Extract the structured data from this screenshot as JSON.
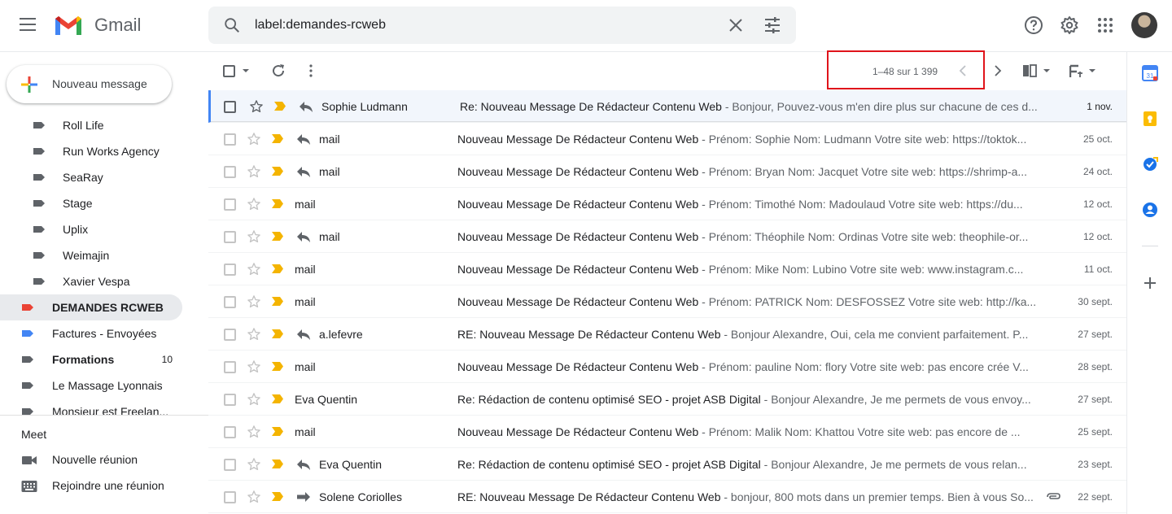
{
  "header": {
    "app_name": "Gmail",
    "search_query": "label:demandes-rcweb"
  },
  "sidebar": {
    "compose_label": "Nouveau message",
    "items": [
      {
        "label": "Roll Life",
        "color": "#5f6368"
      },
      {
        "label": "Run Works Agency",
        "color": "#5f6368"
      },
      {
        "label": "SeaRay",
        "color": "#5f6368"
      },
      {
        "label": "Stage",
        "color": "#5f6368"
      },
      {
        "label": "Uplix",
        "color": "#5f6368"
      },
      {
        "label": "Weimajin",
        "color": "#5f6368"
      },
      {
        "label": "Xavier Vespa",
        "color": "#5f6368"
      },
      {
        "label": "DEMANDES RCWEB",
        "color": "#ea4335",
        "active": true
      },
      {
        "label": "Factures - Envoyées",
        "color": "#4285f4"
      },
      {
        "label": "Formations",
        "color": "#5f6368",
        "count": "10",
        "bold": true
      },
      {
        "label": "Le Massage Lyonnais",
        "color": "#5f6368"
      },
      {
        "label": "Monsieur est Freelan...",
        "color": "#5f6368"
      }
    ],
    "meet": {
      "title": "Meet",
      "new_meeting": "Nouvelle réunion",
      "join_meeting": "Rejoindre une réunion"
    }
  },
  "toolbar": {
    "pagination": "1–48 sur 1 399"
  },
  "emails": [
    {
      "sender": "Sophie Ludmann",
      "reply": true,
      "subject": "Re: Nouveau Message De Rédacteur Contenu Web",
      "snippet": " - Bonjour, Pouvez-vous m'en dire plus sur chacune de ces d...",
      "date": "1 nov."
    },
    {
      "sender": "mail",
      "reply": true,
      "subject": "Nouveau Message De Rédacteur Contenu Web",
      "snippet": " - Prénom: Sophie Nom: Ludmann Votre site web: https://toktok...",
      "date": "25 oct."
    },
    {
      "sender": "mail",
      "reply": true,
      "subject": "Nouveau Message De Rédacteur Contenu Web",
      "snippet": " - Prénom: Bryan Nom: Jacquet Votre site web: https://shrimp-a...",
      "date": "24 oct."
    },
    {
      "sender": "mail",
      "reply": false,
      "subject": "Nouveau Message De Rédacteur Contenu Web",
      "snippet": " - Prénom: Timothé Nom: Madoulaud Votre site web: https://du...",
      "date": "12 oct."
    },
    {
      "sender": "mail",
      "reply": true,
      "subject": "Nouveau Message De Rédacteur Contenu Web",
      "snippet": " - Prénom: Théophile Nom: Ordinas Votre site web: theophile-or...",
      "date": "12 oct."
    },
    {
      "sender": "mail",
      "reply": false,
      "subject": "Nouveau Message De Rédacteur Contenu Web",
      "snippet": " - Prénom: Mike Nom: Lubino Votre site web: www.instagram.c...",
      "date": "11 oct."
    },
    {
      "sender": "mail",
      "reply": false,
      "subject": "Nouveau Message De Rédacteur Contenu Web",
      "snippet": " - Prénom: PATRICK Nom: DESFOSSEZ Votre site web: http://ka...",
      "date": "30 sept."
    },
    {
      "sender": "a.lefevre",
      "reply": true,
      "subject": "RE: Nouveau Message De Rédacteur Contenu Web",
      "snippet": " - Bonjour Alexandre, Oui, cela me convient parfaitement. P...",
      "date": "27 sept."
    },
    {
      "sender": "mail",
      "reply": false,
      "subject": "Nouveau Message De Rédacteur Contenu Web",
      "snippet": " - Prénom: pauline Nom: flory Votre site web: pas encore crée V...",
      "date": "28 sept."
    },
    {
      "sender": "Eva Quentin",
      "reply": false,
      "subject": "Re: Rédaction de contenu optimisé SEO - projet ASB Digital",
      "snippet": " - Bonjour Alexandre, Je me permets de vous envoy...",
      "date": "27 sept."
    },
    {
      "sender": "mail",
      "reply": false,
      "subject": "Nouveau Message De Rédacteur Contenu Web",
      "snippet": " - Prénom: Malik Nom: Khattou Votre site web: pas encore de ...",
      "date": "25 sept."
    },
    {
      "sender": "Eva Quentin",
      "reply": true,
      "subject": "Re: Rédaction de contenu optimisé SEO - projet ASB Digital",
      "snippet": " - Bonjour Alexandre, Je me permets de vous relan...",
      "date": "23 sept."
    },
    {
      "sender": "Solene Coriolles",
      "forward": true,
      "attachment": true,
      "subject": "RE: Nouveau Message De Rédacteur Contenu Web",
      "snippet": " - bonjour, 800 mots dans un premier temps. Bien à vous So...",
      "date": "22 sept."
    }
  ],
  "colors": {
    "important": "#f4b400",
    "highlight_box": "#e0141b"
  }
}
